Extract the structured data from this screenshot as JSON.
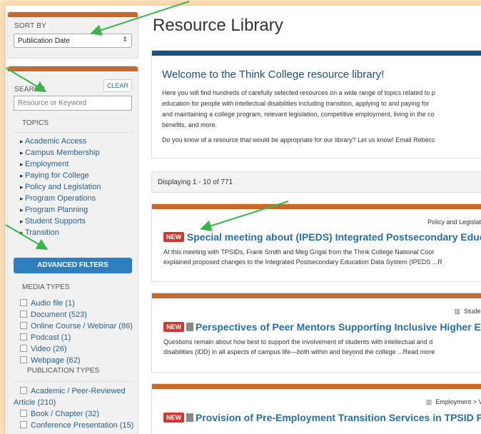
{
  "sort": {
    "label": "SORT BY",
    "selected": "Publication Date"
  },
  "search": {
    "label": "SEARCH",
    "placeholder": "Resource or Keyword",
    "clear": "CLEAR"
  },
  "topics": {
    "label": "TOPICS",
    "items": [
      "Academic Access",
      "Campus Membership",
      "Employment",
      "Paying for College",
      "Policy and Legislation",
      "Program Operations",
      "Program Planning",
      "Student Supports",
      "Transition"
    ]
  },
  "advanced": "ADVANCED FILTERS",
  "media": {
    "label": "MEDIA TYPES",
    "items": [
      "Audio file (1)",
      "Document (523)",
      "Online Course / Webinar (86)",
      "Podcast (1)",
      "Video (26)",
      "Webpage (62)"
    ]
  },
  "pubtypes": {
    "label": "PUBLICATION TYPES",
    "items": [
      "Academic / Peer-Reviewed",
      "Article (210)",
      "Book / Chapter (32)",
      "Conference Presentation (15)"
    ]
  },
  "page": {
    "title": "Resource Library"
  },
  "welcome": {
    "heading": "Welcome to the Think College resource library!",
    "lines": [
      "Here you will find hundreds of carefully selected resources on a wide range of topics related to p",
      "education for people with intellectual disabilities including transition, applying to and paying for",
      "and maintaining a college program, relevant legislation, competitive employment, living in the co",
      "benefits, and more."
    ],
    "question": "Do you know of a resource that would be appropriate for our library? Let us know! Email Rebecc"
  },
  "display": "Displaying 1 - 10 of 771",
  "results": [
    {
      "tag": "Policy and Legislatio",
      "new": "NEW",
      "title": "Special meeting about (IPEDS) Integrated Postsecondary Educatio",
      "desc": [
        "At this meeting with TPSIDs, Frank Smith and Meg Grigal from the Think College National Coor",
        "explained proposed changes to the Integrated Postsecondary Education Data System (IPEDS  ...R"
      ]
    },
    {
      "tag": "Student",
      "new": "NEW",
      "title": "Perspectives of Peer Mentors Supporting Inclusive Higher Educa",
      "desc": [
        "Questions remain about how best to support the involvement of students with intellectual and d",
        "disabilities (IDD) in all aspects of campus life—both within and beyond the college  ...Read more"
      ]
    },
    {
      "tag": "Employment > Vo",
      "new": "NEW",
      "title": "Provision of Pre-Employment Transition Services in TPSID Progr"
    }
  ]
}
